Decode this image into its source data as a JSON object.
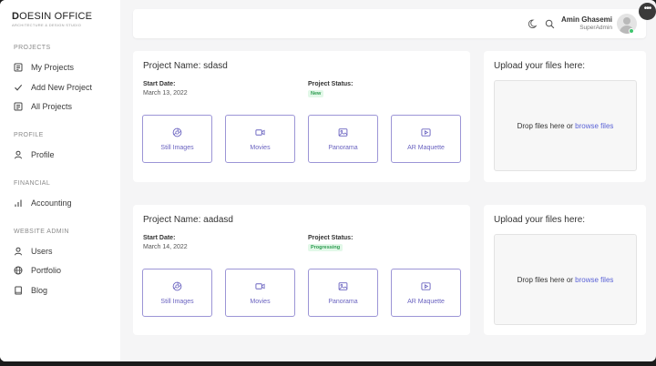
{
  "brand": {
    "name_bold": "D",
    "name_rest": "OESIN OFFICE",
    "subtitle": "ARCHITECTURE & DESIGN STUDIO"
  },
  "sidebar": {
    "sections": [
      {
        "title": "PROJECTS"
      },
      {
        "title": "PROFILE"
      },
      {
        "title": "FINANCIAL"
      },
      {
        "title": "WEBSITE ADMIN"
      }
    ],
    "items": [
      {
        "label": "My Projects",
        "icon": "grid-list-icon"
      },
      {
        "label": "Add New Project",
        "icon": "check-icon"
      },
      {
        "label": "All Projects",
        "icon": "grid-list-icon"
      },
      {
        "label": "Profile",
        "icon": "user-icon"
      },
      {
        "label": "Accounting",
        "icon": "bar-chart-icon"
      },
      {
        "label": "Users",
        "icon": "users-icon"
      },
      {
        "label": "Portfolio",
        "icon": "globe-icon"
      },
      {
        "label": "Blog",
        "icon": "book-icon"
      }
    ]
  },
  "topbar": {
    "user_name": "Amin Ghasemi",
    "user_role": "SuperAdmin",
    "theme_icon": "moon-icon",
    "search_icon": "search-icon",
    "more_label": "•••"
  },
  "projects": [
    {
      "name_label": "Project Name: sdasd",
      "start_label": "Start Date:",
      "start_value": "March 13, 2022",
      "status_label": "Project Status:",
      "status_value": "New",
      "buttons": [
        "Still Images",
        "Movies",
        "Panorama",
        "AR Maquette"
      ],
      "upload_title": "Upload your files here:",
      "drop_text": "Drop files here or ",
      "browse_text": "browse files"
    },
    {
      "name_label": "Project Name: aadasd",
      "start_label": "Start Date:",
      "start_value": "March 14, 2022",
      "status_label": "Project Status:",
      "status_value": "Progressing",
      "buttons": [
        "Still Images",
        "Movies",
        "Panorama",
        "AR Maquette"
      ],
      "upload_title": "Upload your files here:",
      "drop_text": "Drop files here or ",
      "browse_text": "browse files"
    }
  ],
  "colors": {
    "accent": "#6a63c0",
    "link": "#5b63d6",
    "status_green": "#2c9b4f",
    "online": "#3ec46d"
  }
}
